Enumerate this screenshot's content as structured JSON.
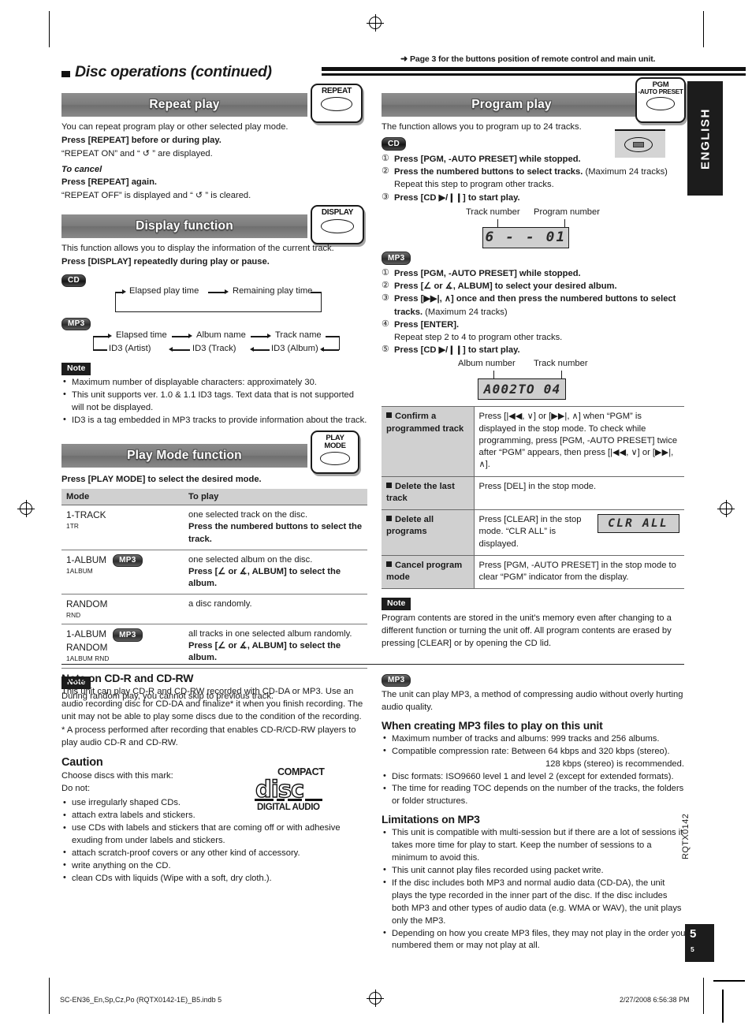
{
  "header": {
    "ref_note": "Page 3 for the buttons position of remote control and main unit.",
    "title": "Disc operations (continued)",
    "language_tab": "ENGLISH"
  },
  "page": {
    "number_big": "5",
    "number_small": "5",
    "code": "RQTX0142"
  },
  "repeat_play": {
    "heading": "Repeat play",
    "button_label": "REPEAT",
    "intro": "You can repeat program play or other selected play mode.",
    "instruction": "Press [REPEAT] before or during play.",
    "result": "“REPEAT ON” and “ ↺ ” are displayed.",
    "cancel_heading": "To cancel",
    "cancel_instruction": "Press [REPEAT] again.",
    "cancel_result": "“REPEAT OFF” is displayed and “ ↺ ” is cleared."
  },
  "display_function": {
    "heading": "Display function",
    "button_label": "DISPLAY",
    "intro": "This function allows you to display the information of the current track.",
    "instruction": "Press [DISPLAY] repeatedly during play or pause.",
    "cd_pill": "CD",
    "mp3_pill": "MP3",
    "cd_flow": [
      "Elapsed play time",
      "Remaining play time"
    ],
    "mp3_flow_top": [
      "Elapsed time",
      "Album name",
      "Track name"
    ],
    "mp3_flow_bottom": [
      "ID3 (Artist)",
      "ID3 (Track)",
      "ID3 (Album)"
    ],
    "note_tag": "Note",
    "notes": [
      "Maximum number of displayable characters: approximately 30.",
      "This unit supports ver. 1.0 & 1.1 ID3 tags. Text data that is not supported will not be displayed.",
      "ID3 is a tag embedded in MP3 tracks to provide information about the track."
    ]
  },
  "play_mode": {
    "heading": "Play Mode function",
    "button_label_line1": "PLAY",
    "button_label_line2": "MODE",
    "instruction": "Press [PLAY MODE] to select the desired mode.",
    "columns": [
      "Mode",
      "To play"
    ],
    "rows": [
      {
        "mode": "1-TRACK",
        "mode_sub": "1TR",
        "pill": "",
        "lines": [
          "one selected track on the disc.",
          "Press the numbered buttons to select the track."
        ],
        "bold_parts": [
          "",
          "Press the numbered buttons to select the track."
        ]
      },
      {
        "mode": "1-ALBUM",
        "mode_sub": "1ALBUM",
        "pill": "MP3",
        "lines": [
          "one selected album on the disc.",
          "Press [∠ or ∡, ALBUM] to select the album."
        ],
        "bold_parts": [
          "",
          "Press [∠ or ∡, ALBUM] to select the album."
        ]
      },
      {
        "mode": "RANDOM",
        "mode_sub": "RND",
        "pill": "",
        "lines": [
          "a disc randomly."
        ],
        "bold_parts": [
          ""
        ]
      },
      {
        "mode": "1-ALBUM",
        "mode2": "RANDOM",
        "mode_sub": "1ALBUM RND",
        "pill": "MP3",
        "lines": [
          "all tracks in one selected album randomly.",
          "Press [∠ or ∡, ALBUM] to select the album."
        ],
        "bold_parts": [
          "",
          "Press [∠ or ∡, ALBUM] to select the album."
        ]
      }
    ],
    "note_tag": "Note",
    "note": "During random play, you cannot skip to previous track."
  },
  "program_play": {
    "heading": "Program play",
    "button_label_line1": "PGM",
    "button_label_line2": "-AUTO PRESET",
    "intro": "The function allows you to program up to 24 tracks.",
    "cd_pill": "CD",
    "mp3_pill": "MP3",
    "cd_steps": [
      {
        "num": "①",
        "bold": "Press [PGM, -AUTO PRESET] while stopped.",
        "plain": ""
      },
      {
        "num": "②",
        "bold": "Press the numbered buttons to select tracks.",
        "plain": " (Maximum 24 tracks)",
        "sub": "Repeat this step to program other tracks."
      },
      {
        "num": "③",
        "bold": "Press [CD ▶/❙❙] to start play.",
        "plain": ""
      }
    ],
    "cd_display": {
      "caption_left": "Track number",
      "caption_right": "Program number",
      "segments": "6  - -  01"
    },
    "mp3_steps": [
      {
        "num": "①",
        "bold": "Press [PGM, -AUTO PRESET] while stopped.",
        "plain": ""
      },
      {
        "num": "②",
        "bold": "Press [∠ or ∡, ALBUM] to select your desired album.",
        "plain": ""
      },
      {
        "num": "③",
        "bold": "Press [▶▶|, ∧] once and then press the numbered buttons to select tracks.",
        "plain": " (Maximum 24 tracks)"
      },
      {
        "num": "④",
        "bold": "Press [ENTER].",
        "plain": "",
        "sub": "Repeat step 2 to 4 to program other tracks."
      },
      {
        "num": "⑤",
        "bold": "Press [CD ▶/❙❙] to start play.",
        "plain": ""
      }
    ],
    "mp3_display": {
      "caption_left": "Album number",
      "caption_right": "Track number",
      "segments": "A002TO 04"
    },
    "ops": [
      {
        "label": "Confirm a programmed track",
        "text": "Press [|◀◀, ∨] or [▶▶|, ∧] when “PGM” is displayed in the stop mode. To check while programming, press [PGM, -AUTO PRESET] twice after “PGM” appears, then press [|◀◀, ∨] or [▶▶|, ∧]."
      },
      {
        "label": "Delete the last track",
        "text": "Press [DEL] in the stop mode."
      },
      {
        "label": "Delete all programs",
        "text": "Press [CLEAR] in the stop mode. “CLR ALL” is displayed.",
        "lcd": "CLR ALL"
      },
      {
        "label": "Cancel program mode",
        "text": "Press [PGM, -AUTO PRESET] in the stop mode to clear “PGM” indicator from the display."
      }
    ],
    "note_tag": "Note",
    "note": "Program contents are stored in the unit's memory even after changing to a different function or turning the unit off. All program contents are erased by pressing [CLEAR] or by opening the CD lid."
  },
  "cdr_note": {
    "heading": "Note on CD-R and CD-RW",
    "body": "This unit can play CD-R and CD-RW recorded with CD-DA or MP3. Use an audio recording disc for CD-DA and finalize* it when you finish recording. The unit may not be able to play some discs due to the condition of the recording.",
    "footnote": "* A process performed after recording that enables CD-R/CD-RW players to play audio CD-R and CD-RW."
  },
  "caution": {
    "heading": "Caution",
    "line1": "Choose discs with this mark:",
    "line2": "Do not:",
    "items": [
      "use irregularly shaped CDs.",
      "attach extra labels and stickers.",
      "use CDs with labels and stickers that are coming off or with adhesive exuding from under labels and stickers.",
      "attach scratch-proof covers or any other kind of accessory.",
      "write anything on the CD.",
      "clean CDs with liquids (Wipe with a soft, dry cloth.)."
    ],
    "logo": {
      "top": "COMPACT",
      "mid": "disc",
      "bottom": "DIGITAL AUDIO"
    }
  },
  "mp3_info": {
    "pill": "MP3",
    "intro": "The unit can play MP3, a method of compressing audio without overly hurting audio quality.",
    "creating_heading": "When creating MP3 files to play on this unit",
    "creating_items": [
      "Maximum number of tracks and albums: 999 tracks and 256 albums.",
      "Compatible compression rate: Between 64 kbps and 320 kbps (stereo).",
      "Disc formats: ISO9660 level 1 and level 2 (except for extended formats).",
      "The time for reading TOC depends on the number of the tracks, the folders or folder structures."
    ],
    "creating_indent_note": "128 kbps (stereo) is recommended.",
    "limitations_heading": "Limitations on MP3",
    "limitations_items": [
      "This unit is compatible with multi-session but if there are a lot of sessions it takes more time for play to start. Keep the number of sessions to a minimum to avoid this.",
      "This unit cannot play files recorded using packet write.",
      "If the disc includes both MP3 and normal audio data (CD-DA), the unit plays the type recorded in the inner part of the disc. If the disc includes both MP3 and other types of audio data (e.g. WMA or WAV), the unit plays only the MP3.",
      "Depending on how you create MP3 files, they may not play in the order you numbered them or may not play at all."
    ]
  },
  "footer": {
    "left": "SC-EN36_En,Sp,Cz,Po (RQTX0142-1E)_B5.indb   5",
    "right": "2/27/2008   6:56:38 PM"
  }
}
